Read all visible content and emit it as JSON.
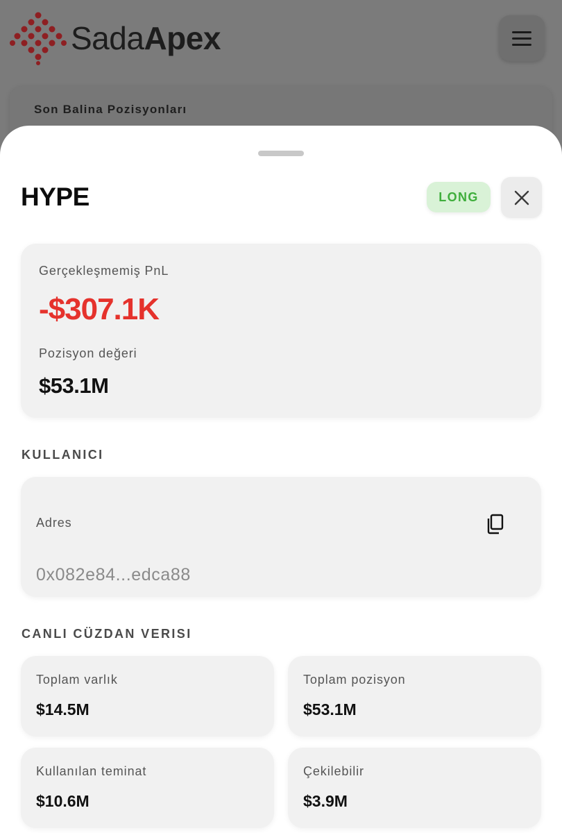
{
  "brand": {
    "name_light": "Sada",
    "name_bold": "Apex"
  },
  "background": {
    "card_title": "Son Balina Pozisyonları"
  },
  "sheet": {
    "title": "HYPE",
    "side_badge": "LONG",
    "pnl": {
      "label": "Gerçekleşmemiş PnL",
      "value": "-$307.1K",
      "position_label": "Pozisyon değeri",
      "position_value": "$53.1M"
    },
    "user_section": {
      "title": "KULLANICI",
      "address_label": "Adres",
      "address_value": "0x082e84...edca88"
    },
    "wallet_section": {
      "title": "CANLI CÜZDAN VERISI",
      "stats": [
        {
          "label": "Toplam varlık",
          "value": "$14.5M"
        },
        {
          "label": "Toplam pozisyon",
          "value": "$53.1M"
        },
        {
          "label": "Kullanılan teminat",
          "value": "$10.6M"
        },
        {
          "label": "Çekilebilir",
          "value": "$3.9M"
        }
      ]
    }
  },
  "icons": {
    "logo": "dots-logo-icon",
    "menu": "hamburger-menu-icon",
    "close": "close-icon",
    "copy": "copy-icon"
  },
  "colors": {
    "pnl_negative": "#e5322c",
    "badge_bg": "#d9f2d7",
    "badge_text": "#3fae3c",
    "logo_red": "#8e1f22"
  }
}
